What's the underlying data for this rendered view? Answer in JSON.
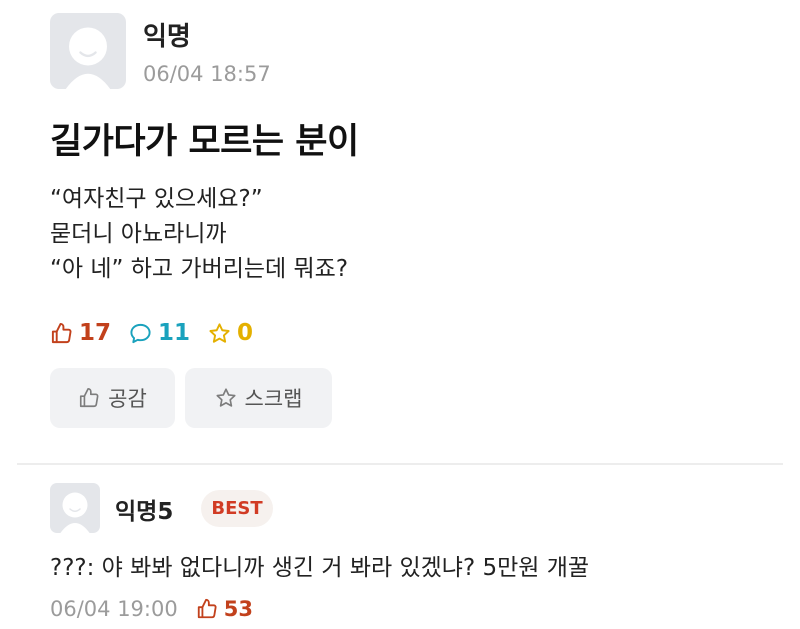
{
  "post": {
    "author": "익명",
    "time": "06/04 18:57",
    "title": "길가다가 모르는 분이",
    "body_lines": [
      "“여자친구 있으세요?”",
      "묻더니 아뇨라니까",
      "“아 네” 하고 가버리는데 뭐죠?"
    ],
    "stats": {
      "likes": "17",
      "comments": "11",
      "scraps": "0"
    },
    "like_button_label": "공감",
    "scrap_button_label": "스크랩"
  },
  "comment": {
    "author": "익명5",
    "badge": "BEST",
    "text": "???: 야 봐봐 없다니까 생긴 거 봐라 있겠냐? 5만원 개꿀",
    "time": "06/04 19:00",
    "likes": "53"
  },
  "icons": {
    "avatar": "anonymous-avatar-icon",
    "like": "thumbs-up-icon",
    "comment": "speech-bubble-icon",
    "scrap": "star-icon"
  },
  "colors": {
    "like": "#c2411c",
    "comment": "#1aa2bd",
    "scrap": "#e4b000",
    "best_badge_text": "#d13b24",
    "best_badge_bg": "#f6f1ee",
    "meta_gray": "#9b9b9b",
    "button_bg": "#f1f2f4",
    "avatar_bg": "#e4e6ea"
  }
}
